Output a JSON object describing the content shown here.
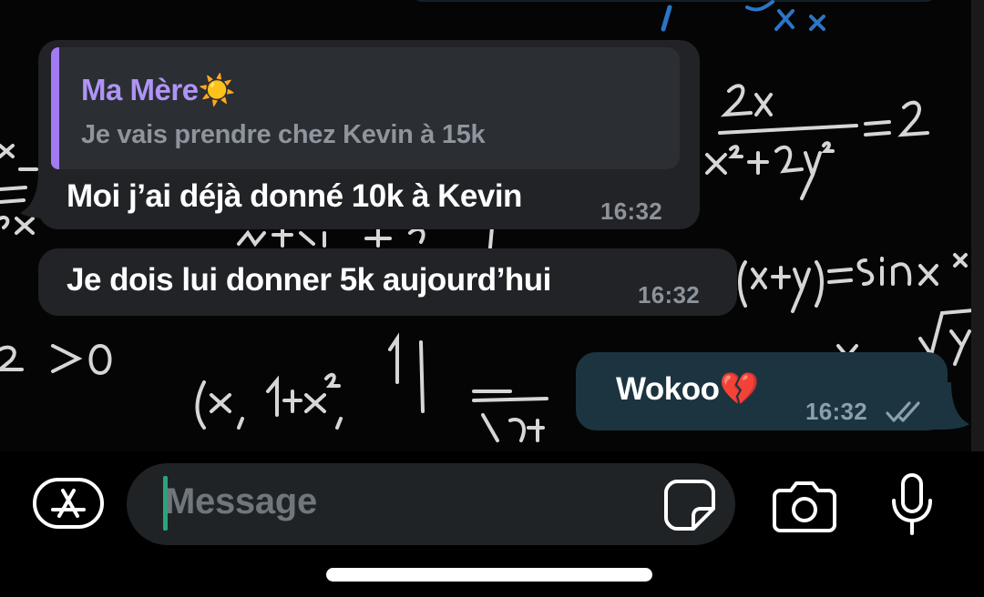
{
  "chat": {
    "messages": [
      {
        "direction": "incoming",
        "reply_to": {
          "sender": "Ma Mère☀️",
          "text": "Je vais prendre chez Kevin à 15k"
        },
        "text": "Moi j’ai déjà donné 10k à Kevin",
        "time": "16:32"
      },
      {
        "direction": "incoming",
        "text": "Je dois lui donner 5k aujourd’hui",
        "time": "16:32"
      },
      {
        "direction": "outgoing",
        "text": "Wokoo💔",
        "time": "16:32",
        "status": "read-double-check"
      }
    ]
  },
  "composer": {
    "placeholder": "Message",
    "buttons": [
      "apps-icon",
      "sticker-icon",
      "camera-icon",
      "microphone-icon"
    ]
  },
  "colors": {
    "incoming_bubble": "#212326",
    "outgoing_bubble": "#1c3440",
    "reply_accent": "#a27af2",
    "reply_name": "#b094f5",
    "cursor": "#2aa57a"
  }
}
